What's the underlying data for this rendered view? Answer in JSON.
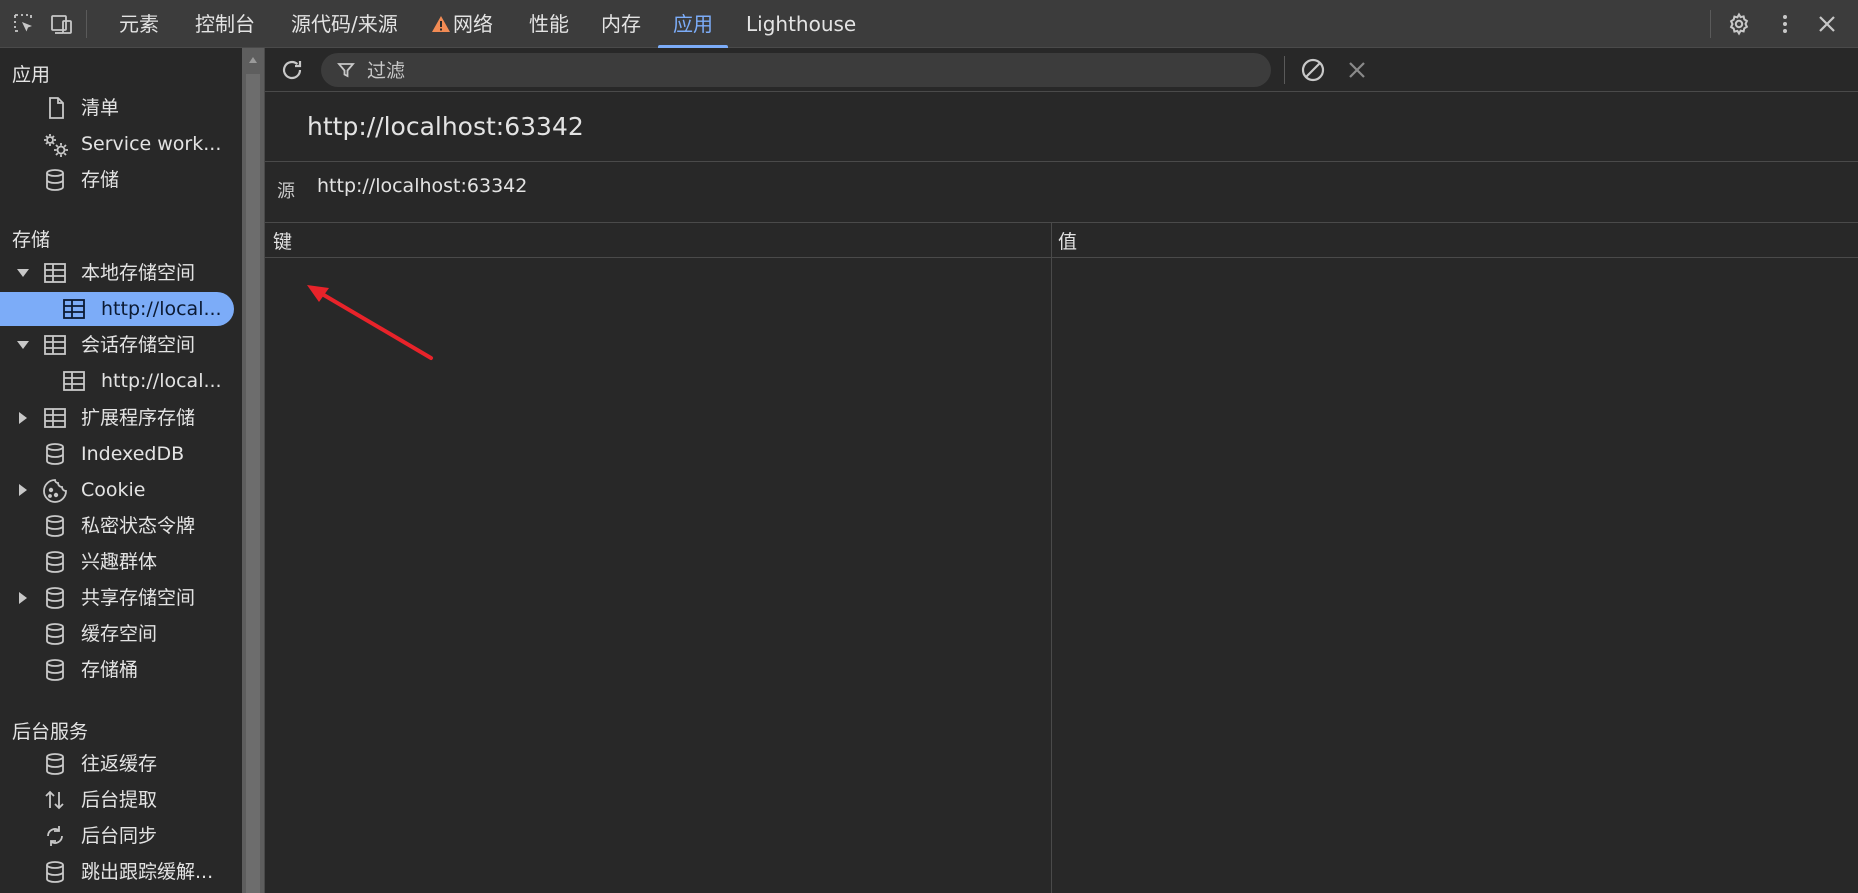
{
  "toolbar_icons": {
    "inspect": "inspect-element-icon",
    "device": "device-toolbar-icon",
    "settings": "gear-icon",
    "more": "more-vertical-icon",
    "close": "close-icon"
  },
  "tabs": [
    {
      "label": "元素",
      "active": false
    },
    {
      "label": "控制台",
      "active": false
    },
    {
      "label": "源代码/来源",
      "active": false
    },
    {
      "label": "网络",
      "active": false,
      "icon": "warning-icon"
    },
    {
      "label": "性能",
      "active": false
    },
    {
      "label": "内存",
      "active": false
    },
    {
      "label": "应用",
      "active": true
    },
    {
      "label": "Lighthouse",
      "active": false
    }
  ],
  "sidebar": {
    "sections": [
      {
        "title": "应用",
        "items": [
          {
            "label": "清单",
            "icon": "document-icon"
          },
          {
            "label": "Service work...",
            "icon": "gears-icon"
          },
          {
            "label": "存储",
            "icon": "database-icon"
          }
        ]
      },
      {
        "title": "存储",
        "items": [
          {
            "label": "本地存储空间",
            "icon": "table-icon",
            "expanded": true
          },
          {
            "label": "http://local...",
            "icon": "table-icon",
            "selected": true,
            "child": true
          },
          {
            "label": "会话存储空间",
            "icon": "table-icon",
            "expanded": true
          },
          {
            "label": "http://local...",
            "icon": "table-icon",
            "child": true
          },
          {
            "label": "扩展程序存储",
            "icon": "table-icon",
            "expanded": false
          },
          {
            "label": "IndexedDB",
            "icon": "database-icon"
          },
          {
            "label": "Cookie",
            "icon": "cookie-icon",
            "expanded": false
          },
          {
            "label": "私密状态令牌",
            "icon": "database-icon"
          },
          {
            "label": "兴趣群体",
            "icon": "database-icon"
          },
          {
            "label": "共享存储空间",
            "icon": "database-icon",
            "expanded": false
          },
          {
            "label": "缓存空间",
            "icon": "database-icon"
          },
          {
            "label": "存储桶",
            "icon": "database-icon"
          }
        ]
      },
      {
        "title": "后台服务",
        "items": [
          {
            "label": "往返缓存",
            "icon": "database-icon"
          },
          {
            "label": "后台提取",
            "icon": "fetch-arrows-icon"
          },
          {
            "label": "后台同步",
            "icon": "sync-icon"
          },
          {
            "label": "跳出跟踪缓解...",
            "icon": "database-icon"
          }
        ]
      }
    ]
  },
  "main": {
    "filter_placeholder": "过滤",
    "origin_title": "http://localhost:63342",
    "origin_label": "源",
    "origin_value": "http://localhost:63342",
    "columns": {
      "key": "键",
      "value": "值"
    },
    "rows": []
  },
  "colors": {
    "accent": "#7cacf8",
    "background": "#282828",
    "toolbar": "#3c3c3c",
    "annotation_arrow": "#e8232a",
    "warning": "#f28b54"
  }
}
